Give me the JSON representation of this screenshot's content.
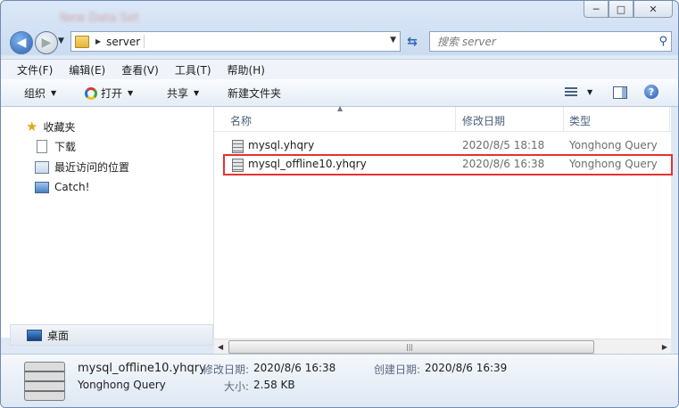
{
  "window": {
    "title": "New Data Set",
    "controls": {
      "minimize": "─",
      "maximize": "□",
      "close": "✕"
    }
  },
  "address": {
    "folder": "server",
    "path_item": "server"
  },
  "search": {
    "placeholder": "搜索 server"
  },
  "menu": [
    "文件(F)",
    "编辑(E)",
    "查看(V)",
    "工具(T)",
    "帮助(H)"
  ],
  "toolbar": {
    "organize": "组织",
    "open": "打开",
    "share": "共享",
    "new_folder": "新建文件夹"
  },
  "nav": {
    "favorites": "收藏夹",
    "downloads": "下载",
    "recent": "最近访问的位置",
    "catch": "Catch!",
    "desktop": "桌面"
  },
  "columns": {
    "name": "名称",
    "modified": "修改日期",
    "type": "类型"
  },
  "files": [
    {
      "name": "mysql.yhqry",
      "modified": "2020/8/5 18:18",
      "type": "Yonghong Query",
      "highlighted": false
    },
    {
      "name": "mysql_offline10.yhqry",
      "modified": "2020/8/6 16:38",
      "type": "Yonghong Query",
      "highlighted": true
    }
  ],
  "details": {
    "name": "mysql_offline10.yhqry",
    "type": "Yonghong Query",
    "modified_label": "修改日期:",
    "modified": "2020/8/6 16:38",
    "created_label": "创建日期:",
    "created": "2020/8/6 16:39",
    "size_label": "大小:",
    "size": "2.58 KB"
  },
  "colors": {
    "highlight_border": "#e23333",
    "accent": "#2d62b5"
  },
  "icons": {
    "back": "back-arrow-icon",
    "forward": "forward-arrow-icon",
    "refresh": "refresh-icon",
    "search": "search-icon",
    "file": "yhqry-file-icon",
    "star": "star-icon"
  }
}
